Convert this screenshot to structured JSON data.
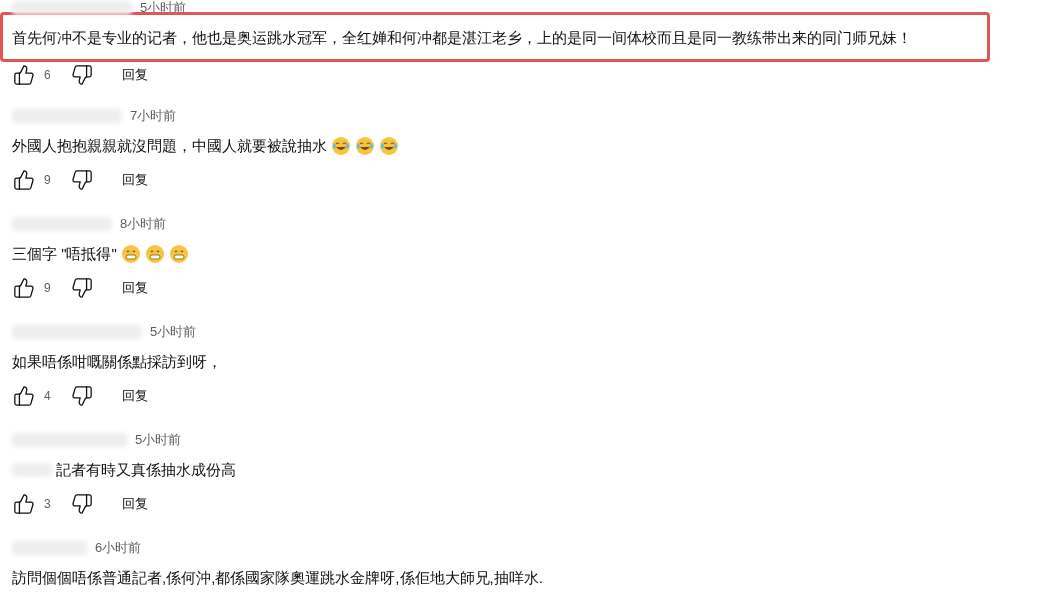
{
  "comments": [
    {
      "time": "5小时前",
      "text": "首先何冲不是专业的记者，他也是奥运跳水冠军，全红婵和何冲都是湛江老乡，上的是同一间体校而且是同一教练带出来的同门师兄妹！",
      "highlighted": true,
      "likes": "6",
      "reply": "回复"
    },
    {
      "time": "7小时前",
      "text": "外國人抱抱親親就沒問題，中國人就要被說抽水",
      "emojis": [
        {
          "kind": "laugh"
        },
        {
          "kind": "laugh"
        },
        {
          "kind": "laugh"
        }
      ],
      "highlighted": false,
      "likes": "9",
      "reply": "回复"
    },
    {
      "time": "8小时前",
      "text": "三個字 \"唔抵得\"",
      "emojis": [
        {
          "kind": "grin"
        },
        {
          "kind": "grin"
        },
        {
          "kind": "grin"
        }
      ],
      "highlighted": false,
      "likes": "9",
      "reply": "回复"
    },
    {
      "time": "5小时前",
      "text": "如果唔係咁嘅關係點採訪到呀，",
      "highlighted": false,
      "likes": "4",
      "reply": "回复"
    },
    {
      "time": "5小时前",
      "text": "記者有時又真係抽水成份高",
      "text_redacted": true,
      "highlighted": false,
      "likes": "3",
      "reply": "回复"
    },
    {
      "time": "6小时前",
      "text": "訪問個個唔係普通記者,係何沖,都係國家隊奧運跳水金牌呀,係佢地大師兄,抽咩水.",
      "highlighted": false
    }
  ]
}
